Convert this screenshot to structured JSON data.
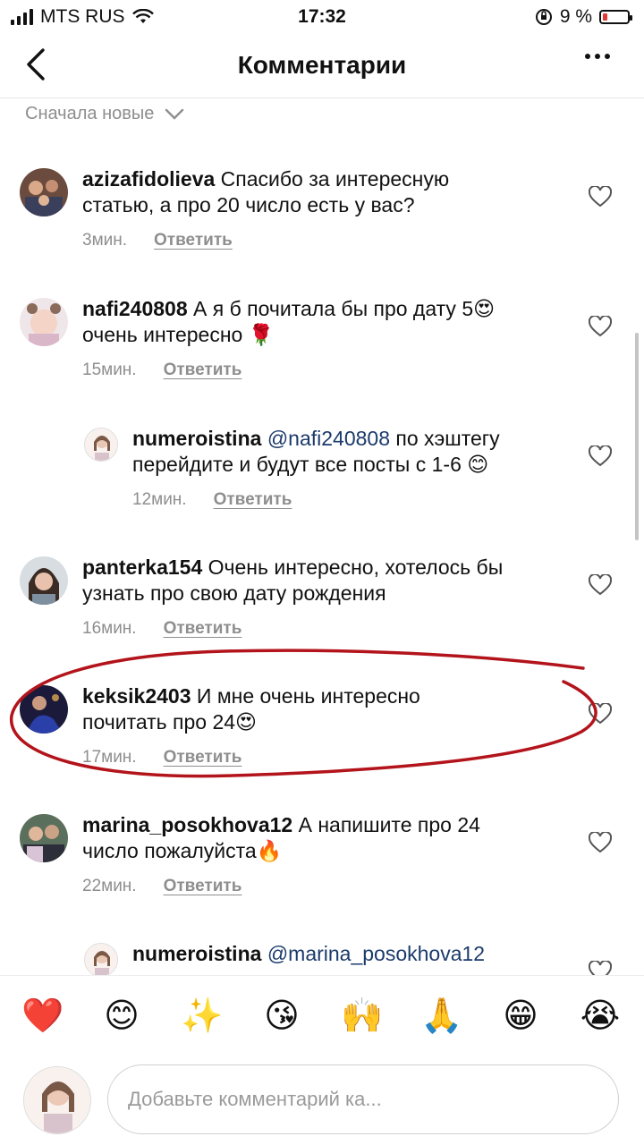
{
  "status": {
    "carrier": "MTS RUS",
    "time": "17:32",
    "battery_percent": "9 %",
    "signal_icon": "signal-bars-icon",
    "wifi_icon": "wifi-icon",
    "battery_level": 0.09
  },
  "header": {
    "title": "Комментарии"
  },
  "sort": {
    "label": "Сначала новые"
  },
  "comments": [
    {
      "user": "azizafidolieva",
      "text": "Спасибо за интересную",
      "text2": "статью, а про 20 число есть у вас?",
      "time": "3мин.",
      "reply": "Ответить"
    },
    {
      "user": "nafi240808",
      "text": "А я б почитала бы про дату 5😍",
      "text2": "очень интересно 🌹",
      "time": "15мин.",
      "reply": "Ответить"
    },
    {
      "user": "numeroistina",
      "mention": "@nafi240808",
      "text": "по хэштегу",
      "text2": "перейдите и будут все посты с 1-6 😊",
      "time": "12мин.",
      "reply": "Ответить"
    },
    {
      "user": "panterka154",
      "text": "Очень интересно, хотелось бы",
      "text2": "узнать про свою дату рождения",
      "time": "16мин.",
      "reply": "Ответить"
    },
    {
      "user": "keksik2403",
      "text": "И мне очень интересно",
      "text2": "почитать про 24😍",
      "time": "17мин.",
      "reply": "Ответить"
    },
    {
      "user": "marina_posokhova12",
      "text": "А напишите про 24",
      "text2": "число пожалуйста🔥",
      "time": "22мин.",
      "reply": "Ответить"
    },
    {
      "user": "numeroistina",
      "mention": "@marina_posokhova12"
    }
  ],
  "emoji_bar": [
    "❤️",
    "😊",
    "✨",
    "😘",
    "🙌",
    "🙏",
    "😁",
    "😭"
  ],
  "input": {
    "placeholder": "Добавьте комментарий ка..."
  },
  "colors": {
    "annotation": "#b3141b",
    "mention": "#1b3a6b",
    "meta": "#8e8e8e"
  }
}
